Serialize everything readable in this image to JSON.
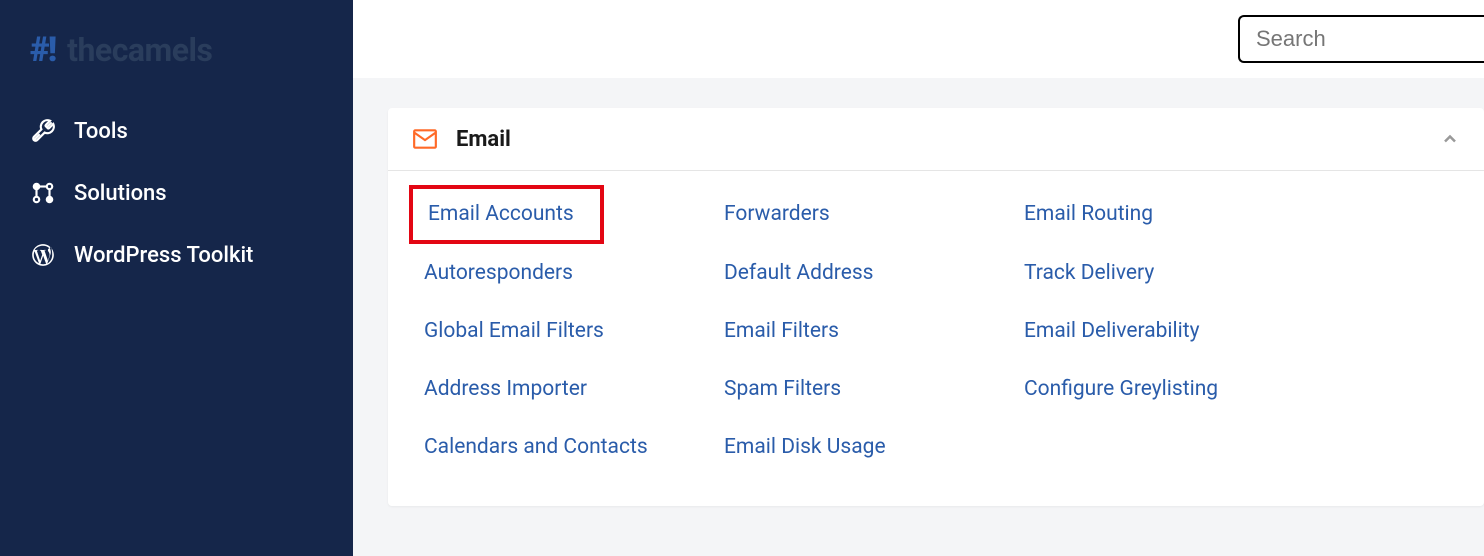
{
  "logo": {
    "mark": "#!",
    "text": "thecamels"
  },
  "sidebar": {
    "items": [
      {
        "label": "Tools",
        "icon": "tools"
      },
      {
        "label": "Solutions",
        "icon": "solutions"
      },
      {
        "label": "WordPress Toolkit",
        "icon": "wordpress"
      }
    ]
  },
  "search": {
    "placeholder": "Search"
  },
  "panel": {
    "title": "Email",
    "links": {
      "col1": [
        {
          "label": "Email Accounts",
          "highlighted": true
        },
        {
          "label": "Autoresponders"
        },
        {
          "label": "Global Email Filters"
        },
        {
          "label": "Address Importer"
        },
        {
          "label": "Calendars and Contacts"
        }
      ],
      "col2": [
        {
          "label": "Forwarders"
        },
        {
          "label": "Default Address"
        },
        {
          "label": "Email Filters"
        },
        {
          "label": "Spam Filters"
        },
        {
          "label": "Email Disk Usage"
        }
      ],
      "col3": [
        {
          "label": "Email Routing"
        },
        {
          "label": "Track Delivery"
        },
        {
          "label": "Email Deliverability"
        },
        {
          "label": "Configure Greylisting"
        }
      ]
    }
  }
}
